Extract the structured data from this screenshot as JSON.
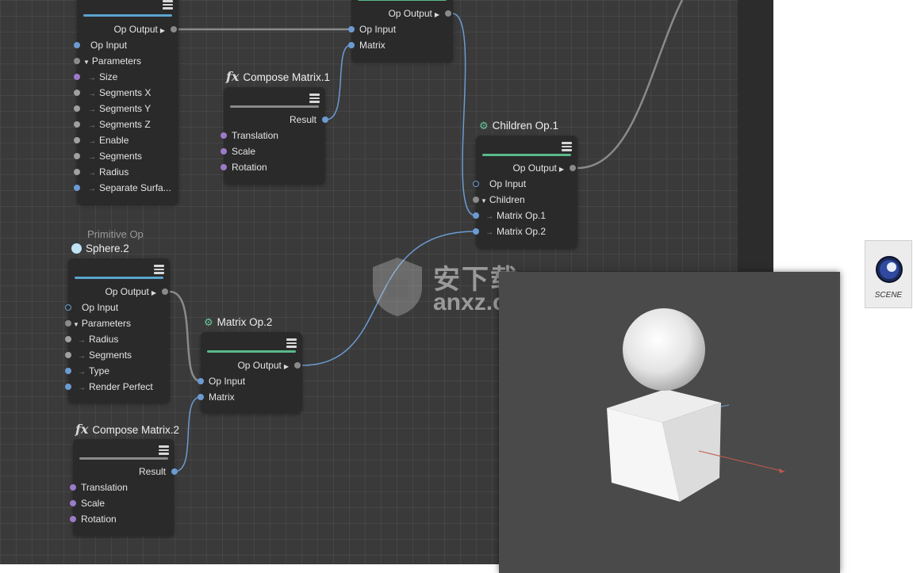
{
  "colors": {
    "canvas_bg": "#3a3a3a",
    "node_bg": "#2a2a2a",
    "bar_blue": "#5ba4cf",
    "bar_green": "#5ab98a",
    "bar_gray": "#8a8a8a",
    "wire_blue": "#6c9bd2",
    "wire_gray": "#8a8a8a"
  },
  "cube_node": {
    "output_label": "Op Output",
    "rows": [
      {
        "label": "Op Input",
        "port": "blue"
      },
      {
        "label": "Parameters",
        "port": "gray",
        "group": true
      },
      {
        "label": "Size",
        "port": "purple"
      },
      {
        "label": "Segments X",
        "port": "gray-light"
      },
      {
        "label": "Segments Y",
        "port": "gray-light"
      },
      {
        "label": "Segments Z",
        "port": "gray-light"
      },
      {
        "label": "Enable",
        "port": "gray-light"
      },
      {
        "label": "Segments",
        "port": "gray-light"
      },
      {
        "label": "Radius",
        "port": "gray-light"
      },
      {
        "label": "Separate Surfa...",
        "port": "blue"
      }
    ]
  },
  "top_matrix_node": {
    "output_label": "Op Output",
    "rows": [
      {
        "label": "Op Input",
        "port": "blue"
      },
      {
        "label": "Matrix",
        "port": "blue"
      }
    ]
  },
  "compose_matrix_1": {
    "icon": "fx-icon",
    "title": "Compose Matrix.1",
    "output_label": "Result",
    "rows": [
      {
        "label": "Translation",
        "port": "purple"
      },
      {
        "label": "Scale",
        "port": "purple"
      },
      {
        "label": "Rotation",
        "port": "purple"
      }
    ]
  },
  "children_op_1": {
    "icon": "gears-icon",
    "title": "Children Op.1",
    "output_label": "Op Output",
    "rows": [
      {
        "label": "Op Input",
        "port": "blue"
      },
      {
        "label": "Children",
        "port": "gray",
        "group": true
      },
      {
        "label": "Matrix Op.1",
        "port": "blue"
      },
      {
        "label": "Matrix Op.2",
        "port": "blue"
      }
    ]
  },
  "sphere_2": {
    "category": "Primitive Op",
    "title": "Sphere.2",
    "output_label": "Op Output",
    "rows": [
      {
        "label": "Op Input",
        "port": "blue"
      },
      {
        "label": "Parameters",
        "port": "gray",
        "group": true
      },
      {
        "label": "Radius",
        "port": "gray-light"
      },
      {
        "label": "Segments",
        "port": "gray-light"
      },
      {
        "label": "Type",
        "port": "blue"
      },
      {
        "label": "Render Perfect",
        "port": "blue"
      }
    ]
  },
  "matrix_op_2": {
    "icon": "gears-icon",
    "title": "Matrix Op.2",
    "output_label": "Op Output",
    "rows": [
      {
        "label": "Op Input",
        "port": "blue"
      },
      {
        "label": "Matrix",
        "port": "blue"
      }
    ]
  },
  "compose_matrix_2": {
    "icon": "fx-icon",
    "title": "Compose Matrix.2",
    "output_label": "Result",
    "rows": [
      {
        "label": "Translation",
        "port": "purple"
      },
      {
        "label": "Scale",
        "port": "purple"
      },
      {
        "label": "Rotation",
        "port": "purple"
      }
    ]
  },
  "scene_file": {
    "icon": "cinema4d-scene-icon",
    "label": "SCENE"
  },
  "watermark": {
    "line1": "安下载",
    "line2": "anxz.com"
  }
}
